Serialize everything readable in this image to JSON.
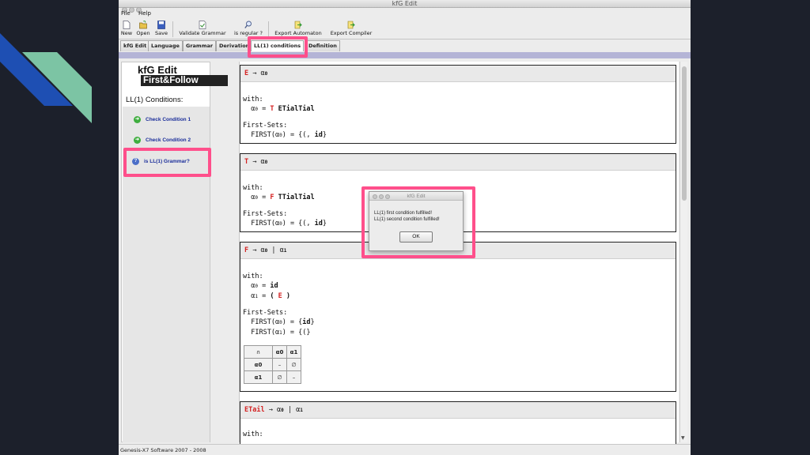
{
  "window": {
    "title": "kfG Edit"
  },
  "menu": {
    "items": [
      "File",
      "Help"
    ]
  },
  "toolbar": {
    "new": "New",
    "open": "Open",
    "save": "Save",
    "validate": "Validate Grammar",
    "is_regular": "is regular ?",
    "export_automaton": "Export Automaton",
    "export_compiler": "Export Compiler"
  },
  "tabs": [
    "kfG Edit",
    "Language",
    "Grammar",
    "Derivation",
    "LL(1) conditions",
    "Definition"
  ],
  "active_tab": "LL(1) conditions",
  "sidebar": {
    "logo_line1": "kfG Edit",
    "logo_line2": "First&Follow",
    "heading": "LL(1) Conditions:",
    "items": [
      {
        "label": "Check Condition 1",
        "icon": "green-arrow-icon"
      },
      {
        "label": "Check Condition 2",
        "icon": "green-arrow-icon"
      },
      {
        "label": "is LL(1) Grammar?",
        "icon": "question-icon"
      }
    ]
  },
  "blocks": [
    {
      "lhs": "E",
      "arrow": "→",
      "rhs": "α",
      "with_label": "with:",
      "a0_eq": "α",
      "a0_sub": "0",
      "a0_val_nt": "T",
      "a0_val_rest": "ETialTial",
      "first_label": "First-Sets:",
      "first_line": "FIRST(α",
      "first_sub": "0",
      "first_val": ") = {(, ",
      "first_bold": "id",
      "first_end": "}"
    },
    {
      "lhs": "T",
      "arrow": "→",
      "rhs": "α",
      "with_label": "with:",
      "a0_eq": "α",
      "a0_sub": "0",
      "a0_val_nt": "F",
      "a0_val_rest": "TTialTial",
      "first_label": "First-Sets:",
      "first_line": "FIRST(α",
      "first_sub": "0",
      "first_val": ") = {(, ",
      "first_bold": "id",
      "first_end": "}"
    },
    {
      "lhs": "F",
      "arrow": "→",
      "rhs0": "α",
      "bar": "|",
      "rhs1": "α",
      "with_label": "with:",
      "a0_val": "id",
      "a1_open": "(",
      "a1_nt": "E",
      "a1_close": ")",
      "first_label": "First-Sets:",
      "first0_val": ") = {",
      "first0_bold": "id",
      "first0_end": "}",
      "first1_val": ") = {(}",
      "table": {
        "corner": "∩",
        "cols": [
          "α0",
          "α1"
        ],
        "rows": [
          {
            "head": "α0",
            "cells": [
              "–",
              "∅"
            ]
          },
          {
            "head": "α1",
            "cells": [
              "∅",
              "–"
            ]
          }
        ]
      }
    },
    {
      "lhs": "ETail",
      "arrow": "→",
      "rhs0": "α",
      "bar": "|",
      "rhs1": "α",
      "with_label": "with:"
    }
  ],
  "dialog": {
    "title": "kfG Edit",
    "line1": "LL(1) first condition fulfilled!",
    "line2": "LL(1) second condition fulfilled!",
    "ok": "OK"
  },
  "status": "Genesis-X7 Software 2007 - 2008",
  "colors": {
    "highlight": "#ff4f8b",
    "nonterminal": "#d42121",
    "link": "#1a2d9a",
    "tabbar_line": "#b4b4d6"
  }
}
